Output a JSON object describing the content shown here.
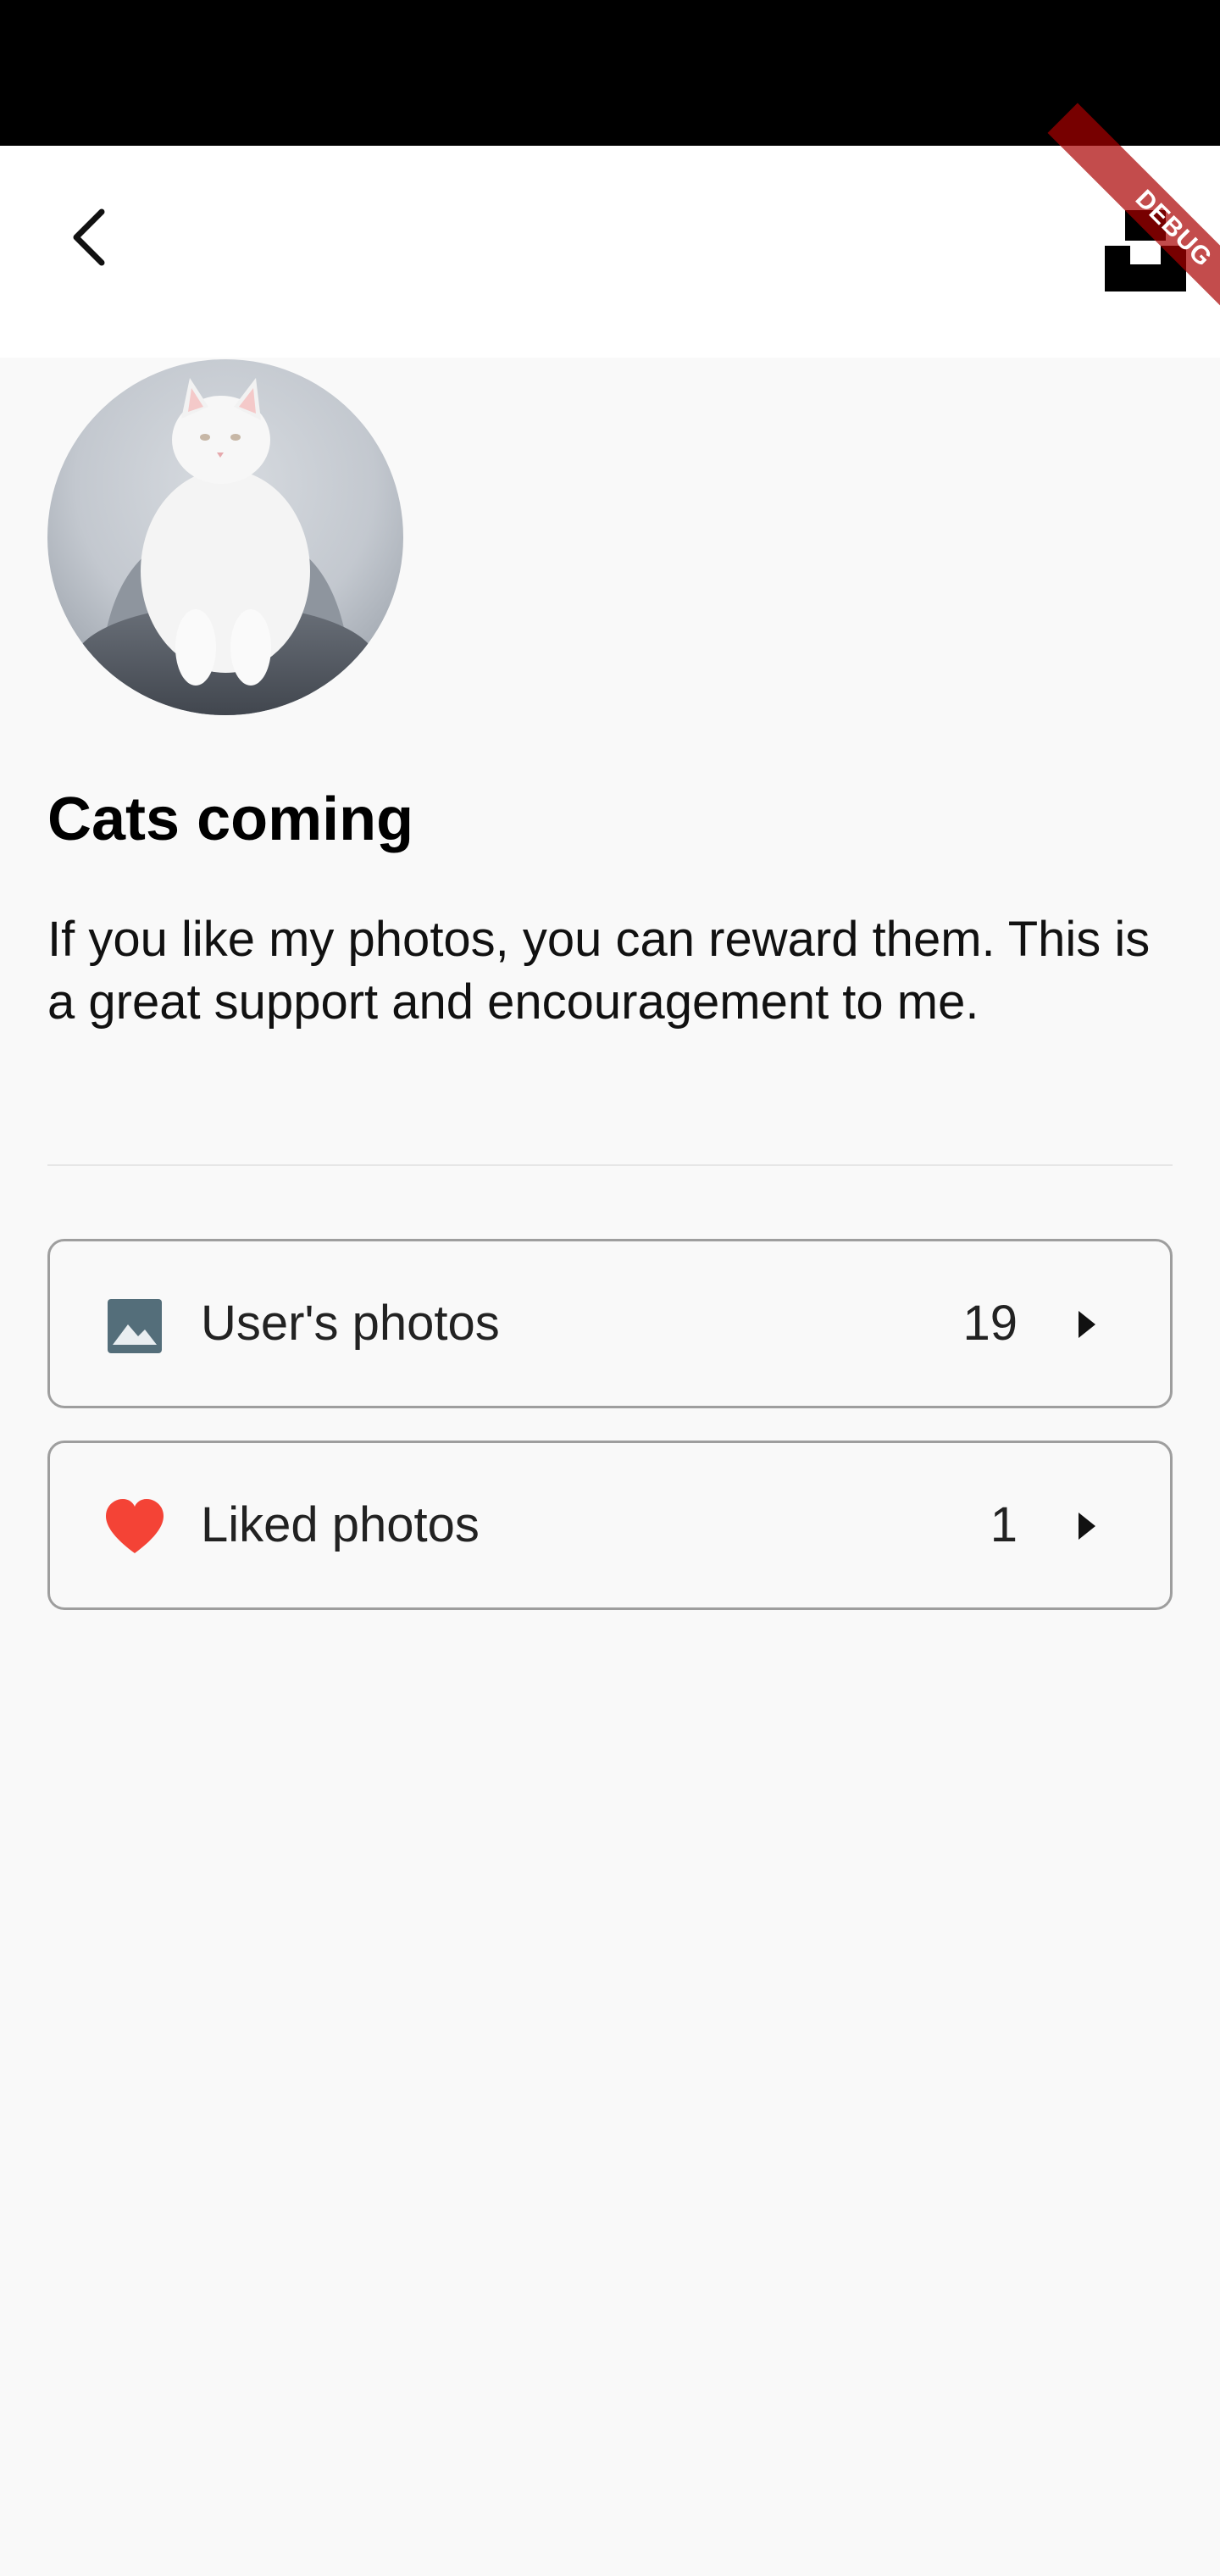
{
  "app_bar": {
    "back_icon": "chevron-left-icon",
    "logo_icon": "unsplash-logo-icon"
  },
  "debug_banner": {
    "label": "DEBUG"
  },
  "profile": {
    "name": "Cats coming",
    "bio": "If you like my photos, you can reward them. This is a great support and encouragement to me."
  },
  "lists": [
    {
      "label": "User's photos",
      "count": "19",
      "icon": "image-icon",
      "icon_color": "#546e7a"
    },
    {
      "label": "Liked photos",
      "count": "1",
      "icon": "heart-icon",
      "icon_color": "#f44336"
    }
  ],
  "colors": {
    "status_bar": "#000000",
    "app_bar": "#ffffff",
    "background": "#f9f9f9",
    "debug_ribbon": "#aa0000"
  }
}
